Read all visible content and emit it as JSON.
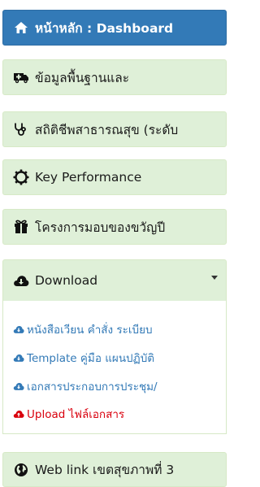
{
  "menu": {
    "items": [
      {
        "label": "หน้าหลัก : Dashboard",
        "icon": "home-icon"
      },
      {
        "label": "ข้อมูลพื้นฐานและ",
        "icon": "ambulance-icon"
      },
      {
        "label": "สถิติชีพสาธารณสุข (ระดับ",
        "icon": "stethoscope-icon"
      },
      {
        "label": "Key Performance",
        "icon": "gear-icon"
      },
      {
        "label": "โครงการมอบของขวัญปี",
        "icon": "gift-icon"
      },
      {
        "label": "Download",
        "icon": "cloud-download-icon"
      },
      {
        "label": "Web link เขตสุขภาพที่ 3",
        "icon": "globe-icon"
      }
    ],
    "download_sub": [
      {
        "label": "หนังสือเวียน คำสั่ง ระเบียบ",
        "icon": "cloud-download-icon"
      },
      {
        "label": "Template คู่มือ แผนปฏิบัติ",
        "icon": "cloud-download-icon"
      },
      {
        "label": "เอกสารประกอบการประชุม/",
        "icon": "cloud-download-icon"
      },
      {
        "label": "Upload ไฟล์เอกสาร",
        "icon": "cloud-upload-icon"
      }
    ]
  },
  "colors": {
    "active_bg": "#337ab7",
    "item_bg": "#dff0d8",
    "link": "#337ab7",
    "upload_link": "#d9000d"
  }
}
